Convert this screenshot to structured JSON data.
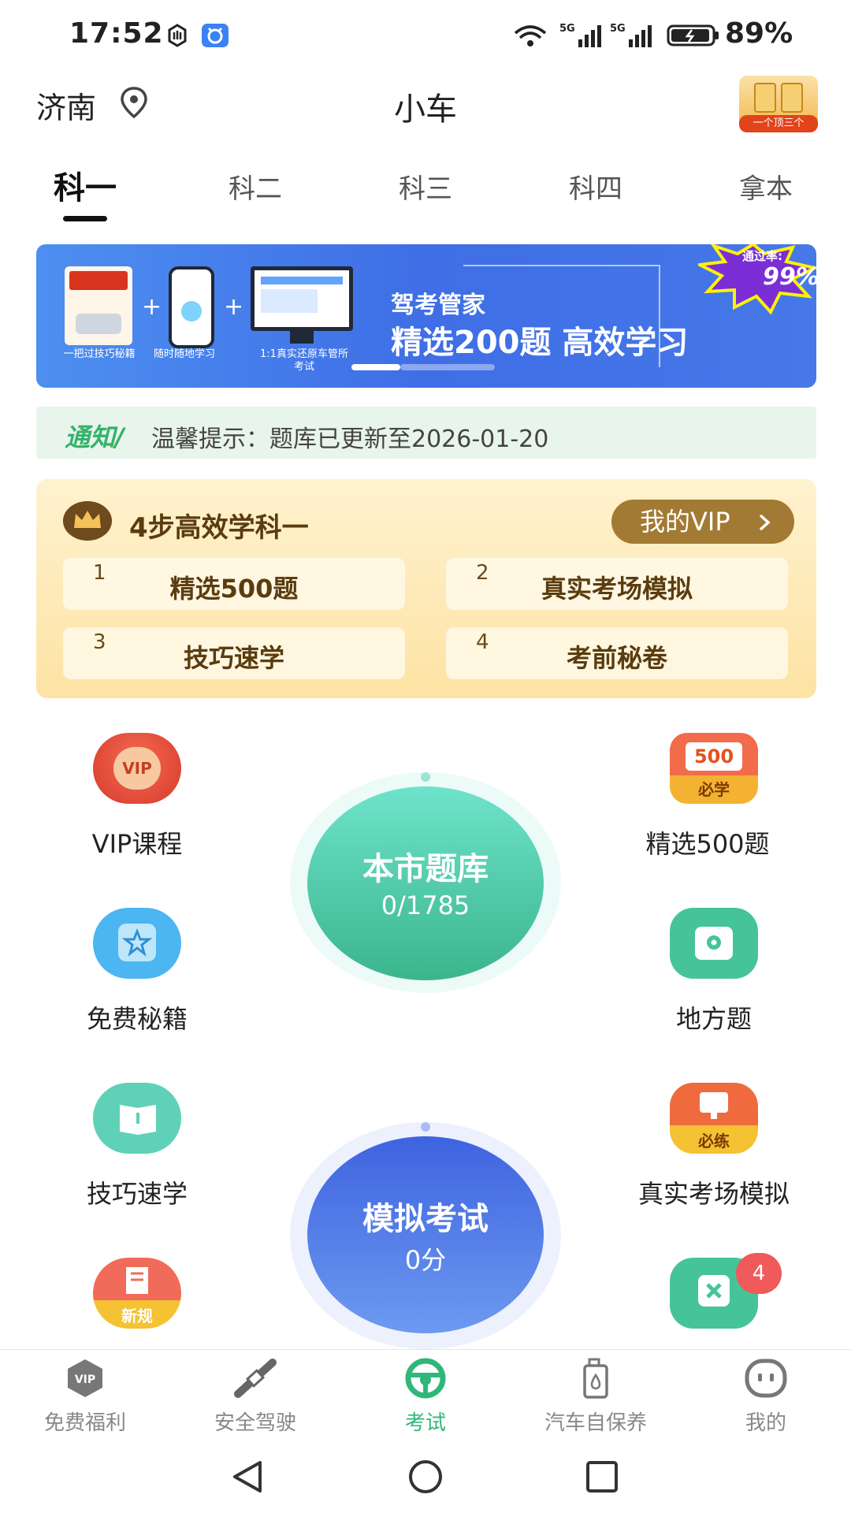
{
  "status_bar": {
    "time": "17:52",
    "battery": "89%"
  },
  "header": {
    "city": "济南",
    "title": "小车",
    "promo_tag": "一个顶三个"
  },
  "tabs": [
    {
      "label": "科一"
    },
    {
      "label": "科二"
    },
    {
      "label": "科三"
    },
    {
      "label": "科四"
    },
    {
      "label": "拿本"
    }
  ],
  "banner": {
    "products": [
      {
        "caption": "一把过技巧秘籍"
      },
      {
        "caption": "随时随地学习"
      },
      {
        "caption": "1:1真实还原车管所考试"
      }
    ],
    "brand": "驾考管家",
    "headline": "精选200题  高效学习",
    "pass_rate_label": "通过率:",
    "pass_rate_value": "99%"
  },
  "notice": {
    "tag": "通知/",
    "text": "温馨提示：题库已更新至2026-01-20"
  },
  "vip_card": {
    "heading": "4步高效学科一",
    "my_vip": "我的VIP",
    "steps": [
      {
        "num": "1",
        "label": "精选500题"
      },
      {
        "num": "2",
        "label": "真实考场模拟"
      },
      {
        "num": "3",
        "label": "技巧速学"
      },
      {
        "num": "4",
        "label": "考前秘卷"
      }
    ]
  },
  "grid": {
    "left": [
      {
        "label": "VIP课程",
        "icon_text": "VIP"
      },
      {
        "label": "免费秘籍",
        "icon_text": ""
      },
      {
        "label": "技巧速学",
        "icon_text": ""
      },
      {
        "label": "",
        "icon_text": "新规"
      }
    ],
    "right": [
      {
        "label": "精选500题",
        "icon_text": "500",
        "icon_sub": "必学"
      },
      {
        "label": "地方题",
        "icon_text": ""
      },
      {
        "label": "真实考场模拟",
        "icon_text": "必练"
      },
      {
        "label": "",
        "icon_text": ""
      }
    ],
    "wrong_badge": "4"
  },
  "center": {
    "bank": {
      "title": "本市题库",
      "progress": "0/1785"
    },
    "exam": {
      "title": "模拟考试",
      "score": "0分"
    }
  },
  "bottom_nav": [
    {
      "label": "免费福利",
      "icon": "vip-shield-icon"
    },
    {
      "label": "安全驾驶",
      "icon": "seatbelt-icon"
    },
    {
      "label": "考试",
      "icon": "steering-wheel-icon"
    },
    {
      "label": "汽车自保养",
      "icon": "oil-can-icon"
    },
    {
      "label": "我的",
      "icon": "profile-face-icon"
    }
  ],
  "colors": {
    "accent_green": "#2fb77a",
    "banner_blue": "#3f6ee6",
    "gold": "#a27a33"
  }
}
